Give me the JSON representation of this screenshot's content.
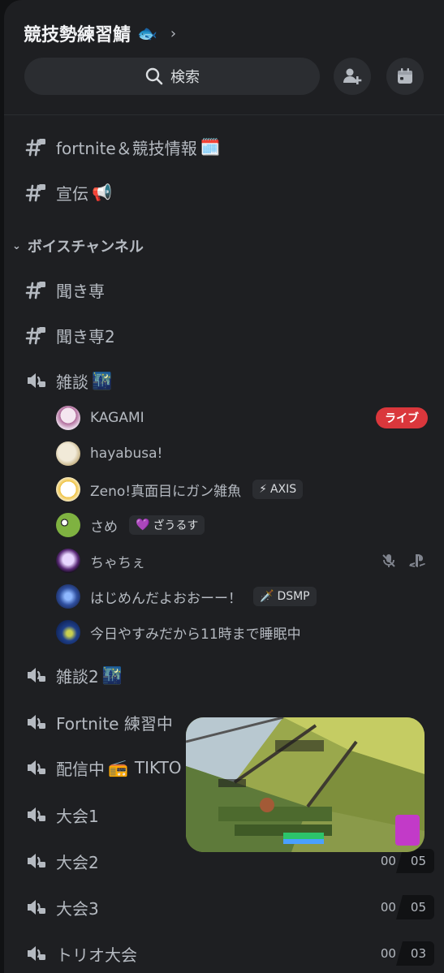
{
  "server": {
    "name": "競技勢練習鯖",
    "name_emoji": "🐟",
    "chevron": "›"
  },
  "search": {
    "label": "検索"
  },
  "channels": [
    {
      "name": "fortnite＆競技情報",
      "emoji": "🗓️",
      "type": "text"
    },
    {
      "name": "宣伝",
      "emoji": "📢",
      "type": "text"
    }
  ],
  "category": {
    "name": "ボイスチャンネル"
  },
  "voice_channels_top": [
    {
      "name": "聞き専",
      "type": "text"
    },
    {
      "name": "聞き専2",
      "type": "text"
    },
    {
      "name": "雑談",
      "emoji": "🌃",
      "type": "voice"
    }
  ],
  "members": [
    {
      "name": "KAGAMI",
      "badge": "ライブ"
    },
    {
      "name": "hayabusa!"
    },
    {
      "name": "Zeno!真面目にガン雑魚",
      "tag_emoji": "⚡",
      "tag": "AXIS"
    },
    {
      "name": "さめ",
      "tag_emoji": "💜",
      "tag": "ざうるす"
    },
    {
      "name": "ちゃちぇ",
      "icons": [
        "mic-muted-icon",
        "playstation-icon"
      ]
    },
    {
      "name": "はじめんだよおおーー！",
      "tag_emoji": "🗡️",
      "tag": "DSMP"
    },
    {
      "name": "今日やすみだから11時まで睡眠中"
    }
  ],
  "voice_channels_bottom": [
    {
      "name": "雑談2",
      "emoji": "🌃"
    },
    {
      "name": "Fortnite 練習中"
    },
    {
      "name": "配信中",
      "emoji": "📻",
      "suffix": "TIKTO"
    },
    {
      "name": "大会1"
    },
    {
      "name": "大会2",
      "count_a": "00",
      "count_b": "05"
    },
    {
      "name": "大会3",
      "count_a": "00",
      "count_b": "05"
    },
    {
      "name": "トリオ大会",
      "count_a": "00",
      "count_b": "03"
    }
  ],
  "colors": {
    "background": "#1e1f22",
    "live": "#da373c",
    "text": "#b5bac1",
    "title": "#f2f3f5"
  }
}
